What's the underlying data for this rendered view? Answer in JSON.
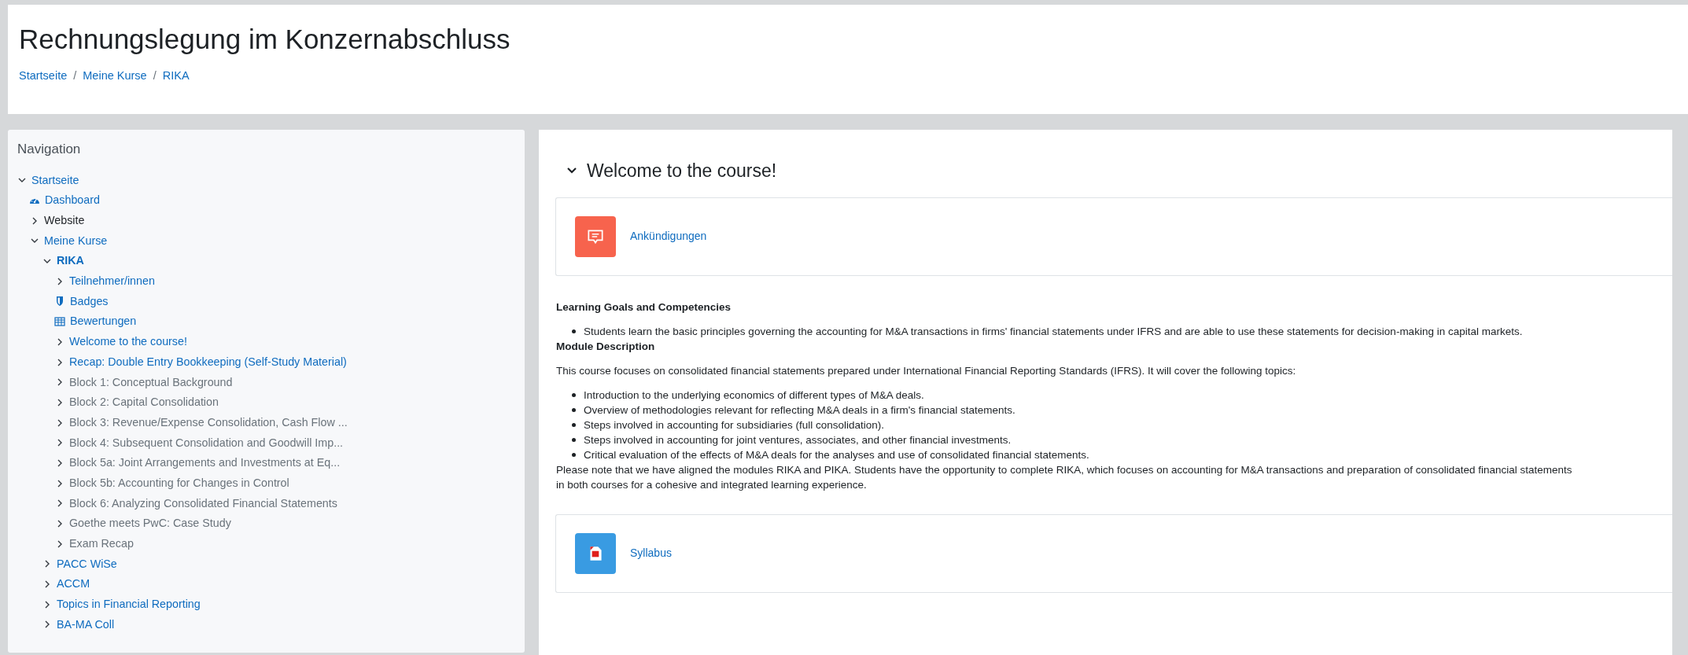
{
  "header": {
    "title": "Rechnungslegung im Konzernabschluss",
    "breadcrumb": [
      "Startseite",
      "Meine Kurse",
      "RIKA"
    ],
    "separator": "/"
  },
  "navigation": {
    "title": "Navigation",
    "items": [
      {
        "label": "Startseite",
        "kind": "branch",
        "expanded": true,
        "link": true,
        "dimmed": false,
        "current": false,
        "children": [
          {
            "label": "Dashboard",
            "kind": "leaf",
            "link": true,
            "dimmed": false,
            "current": false
          },
          {
            "label": "Website",
            "kind": "branch",
            "expanded": false,
            "link": false,
            "dimmed": false,
            "current": false
          },
          {
            "label": "Meine Kurse",
            "kind": "branch",
            "expanded": true,
            "link": true,
            "dimmed": false,
            "current": false,
            "children": [
              {
                "label": "RIKA",
                "kind": "branch",
                "expanded": true,
                "link": true,
                "dimmed": false,
                "current": true,
                "children": [
                  {
                    "label": "Teilnehmer/innen",
                    "kind": "branch",
                    "expanded": false,
                    "link": true,
                    "dimmed": false,
                    "current": false
                  },
                  {
                    "label": "Badges",
                    "kind": "leaf",
                    "link": true,
                    "dimmed": false,
                    "current": false
                  },
                  {
                    "label": "Bewertungen",
                    "kind": "leaf",
                    "link": true,
                    "dimmed": false,
                    "current": false
                  },
                  {
                    "label": "Welcome to the course!",
                    "kind": "branch",
                    "expanded": false,
                    "link": true,
                    "dimmed": false,
                    "current": false
                  },
                  {
                    "label": "Recap: Double Entry Bookkeeping (Self-Study Material)",
                    "kind": "branch",
                    "expanded": false,
                    "link": true,
                    "dimmed": false,
                    "current": false
                  },
                  {
                    "label": "Block 1: Conceptual Background",
                    "kind": "branch",
                    "expanded": false,
                    "link": true,
                    "dimmed": true,
                    "current": false
                  },
                  {
                    "label": "Block 2: Capital Consolidation",
                    "kind": "branch",
                    "expanded": false,
                    "link": true,
                    "dimmed": true,
                    "current": false
                  },
                  {
                    "label": "Block 3: Revenue/Expense Consolidation, Cash Flow ...",
                    "kind": "branch",
                    "expanded": false,
                    "link": true,
                    "dimmed": true,
                    "current": false
                  },
                  {
                    "label": "Block 4: Subsequent Consolidation and Goodwill Imp...",
                    "kind": "branch",
                    "expanded": false,
                    "link": true,
                    "dimmed": true,
                    "current": false
                  },
                  {
                    "label": "Block 5a: Joint Arrangements and Investments at Eq...",
                    "kind": "branch",
                    "expanded": false,
                    "link": true,
                    "dimmed": true,
                    "current": false
                  },
                  {
                    "label": "Block 5b: Accounting for Changes in Control",
                    "kind": "branch",
                    "expanded": false,
                    "link": true,
                    "dimmed": true,
                    "current": false
                  },
                  {
                    "label": "Block 6: Analyzing Consolidated Financial Statements",
                    "kind": "branch",
                    "expanded": false,
                    "link": true,
                    "dimmed": true,
                    "current": false
                  },
                  {
                    "label": "Goethe meets PwC: Case Study",
                    "kind": "branch",
                    "expanded": false,
                    "link": true,
                    "dimmed": true,
                    "current": false
                  },
                  {
                    "label": "Exam Recap",
                    "kind": "branch",
                    "expanded": false,
                    "link": true,
                    "dimmed": true,
                    "current": false
                  }
                ]
              },
              {
                "label": "PACC WiSe",
                "kind": "branch",
                "expanded": false,
                "link": true,
                "dimmed": false,
                "current": false
              },
              {
                "label": "ACCM",
                "kind": "branch",
                "expanded": false,
                "link": true,
                "dimmed": false,
                "current": false
              },
              {
                "label": "Topics in Financial Reporting",
                "kind": "branch",
                "expanded": false,
                "link": true,
                "dimmed": false,
                "current": false
              },
              {
                "label": "BA-MA Coll",
                "kind": "branch",
                "expanded": false,
                "link": true,
                "dimmed": false,
                "current": false
              }
            ]
          }
        ]
      }
    ]
  },
  "section": {
    "title": "Welcome to the course!",
    "expanded": true,
    "activities_top": [
      {
        "label": "Ankündigungen",
        "kind": "forum"
      }
    ],
    "goals_heading": "Learning Goals and Competencies",
    "goals": [
      "Students learn the basic principles governing the accounting for M&A transactions in firms' financial statements under IFRS and are able to use these statements for decision-making in capital markets."
    ],
    "module_heading": "Module Description",
    "module_intro": "This course focuses on consolidated financial statements prepared under International Financial Reporting Standards (IFRS). It will cover the following topics:",
    "topics": [
      "Introduction to the underlying economics of different types of M&A deals.",
      "Overview of methodologies relevant for reflecting M&A deals in a firm's financial statements.",
      "Steps involved in accounting for subsidiaries (full consolidation).",
      "Steps involved in accounting for joint ventures, associates, and other financial investments.",
      "Critical evaluation of the effects of M&A deals for the analyses and use of consolidated financial statements."
    ],
    "note_lines": [
      "Please note that we have aligned the modules RIKA and PIKA. Students have the opportunity to complete RIKA, which focuses on accounting for M&A transactions and preparation of consolidated financial statements",
      "in both courses for a cohesive and integrated learning experience."
    ],
    "activities_bottom": [
      {
        "label": "Syllabus",
        "kind": "pdf"
      }
    ]
  }
}
